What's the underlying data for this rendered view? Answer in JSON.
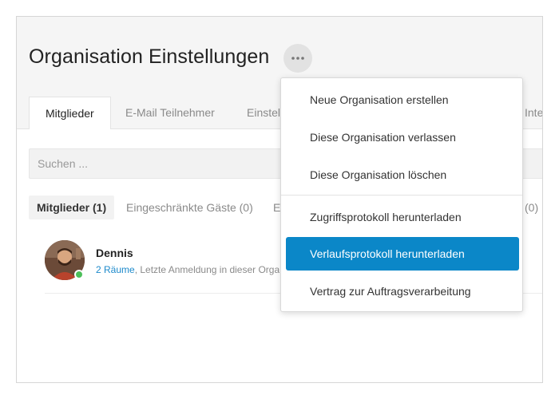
{
  "page": {
    "title": "Organisation Einstellungen"
  },
  "tabs": [
    {
      "label": "Mitglieder",
      "active": true
    },
    {
      "label": "E-Mail Teilnehmer",
      "active": false
    },
    {
      "label": "Einstel",
      "active": false
    },
    {
      "label": "Inte",
      "active": false
    }
  ],
  "search": {
    "placeholder": "Suchen ..."
  },
  "filters": [
    {
      "label": "Mitglieder (1)",
      "active": true
    },
    {
      "label": "Eingeschränkte Gäste (0)",
      "active": false
    },
    {
      "label": "E",
      "active": false
    },
    {
      "label": "(0)",
      "active": false
    }
  ],
  "member": {
    "name": "Dennis",
    "rooms_link": "2 Räume",
    "last_login": ", Letzte Anmeldung in dieser Orga",
    "status": "online"
  },
  "dropdown": {
    "items": [
      {
        "label": "Neue Organisation erstellen"
      },
      {
        "label": "Diese Organisation verlassen"
      },
      {
        "label": "Diese Organisation löschen"
      },
      {
        "label": "Zugriffsprotokoll herunterladen"
      },
      {
        "label": "Verlaufsprotokoll herunterladen"
      },
      {
        "label": "Vertrag zur Auftragsverarbeitung"
      }
    ]
  },
  "colors": {
    "accent": "#0b87c8",
    "link": "#1d8acb",
    "online": "#4cbf5a"
  },
  "icons": {
    "more": "more-horizontal-icon",
    "online": "online-status-dot"
  }
}
